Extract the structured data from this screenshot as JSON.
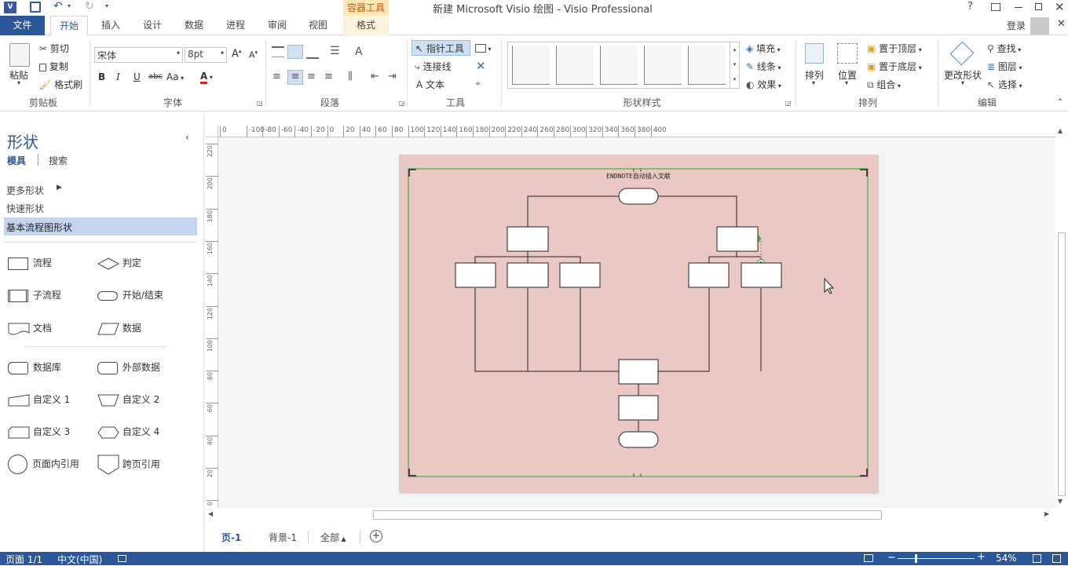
{
  "window": {
    "title": "新建 Microsoft Visio 绘图 - Visio Professional",
    "context_tab_group": "容器工具",
    "help": "?",
    "login": "登录"
  },
  "tabs": [
    "文件",
    "开始",
    "插入",
    "设计",
    "数据",
    "进程",
    "审阅",
    "视图",
    "格式"
  ],
  "ribbon": {
    "clipboard": {
      "paste": "粘贴",
      "cut": "剪切",
      "copy": "复制",
      "format_painter": "格式刷",
      "label": "剪贴板"
    },
    "font": {
      "name": "宋体",
      "size": "8pt",
      "bold": "B",
      "italic": "I",
      "underline": "U",
      "strike": "abc",
      "case": "Aa",
      "color": "A",
      "label": "字体"
    },
    "paragraph": {
      "label": "段落"
    },
    "tools": {
      "pointer": "指针工具",
      "connector": "连接线",
      "text": "文本",
      "label": "工具"
    },
    "shape_styles": {
      "label": "形状样式"
    },
    "shape_format": {
      "fill": "填充",
      "line": "线条",
      "effects": "效果"
    },
    "arrange": {
      "arrange": "排列",
      "position": "位置",
      "bring_front": "置于顶层",
      "send_back": "置于底层",
      "group": "组合",
      "label": "排列"
    },
    "editing": {
      "change_shape": "更改形状",
      "find": "查找",
      "layers": "图层",
      "select": "选择",
      "label": "编辑"
    }
  },
  "shapes_pane": {
    "title": "形状",
    "tab_stencil": "模具",
    "tab_search": "搜索",
    "more_shapes": "更多形状",
    "quick_shapes": "快速形状",
    "selected_stencil": "基本流程图形状",
    "items": [
      "流程",
      "判定",
      "子流程",
      "开始/结束",
      "文档",
      "数据",
      "数据库",
      "外部数据",
      "自定义 1",
      "自定义 2",
      "自定义 3",
      "自定义 4",
      "页面内引用",
      "跨页引用"
    ]
  },
  "rulers": {
    "h": [
      "0",
      "-100",
      "-80",
      "-60",
      "-40",
      "-20",
      "0",
      "20",
      "40",
      "60",
      "80",
      "100",
      "120",
      "140",
      "160",
      "180",
      "200",
      "220",
      "240",
      "260",
      "280",
      "300",
      "320",
      "340",
      "360",
      "380",
      "400"
    ],
    "v": [
      "220",
      "200",
      "180",
      "160",
      "140",
      "120",
      "100",
      "80",
      "60",
      "40",
      "20",
      "0"
    ]
  },
  "diagram": {
    "container_title": "ENDNOTE自动插入文献"
  },
  "page_tabs": {
    "page1": "页-1",
    "background": "背景-1",
    "all": "全部"
  },
  "status": {
    "page": "页面 1/1",
    "language": "中文(中国)",
    "zoom": "54%"
  },
  "colors": {
    "accent": "#2b579a",
    "page_fill": "#ecc8c5",
    "container_border": "#5cb85c"
  }
}
